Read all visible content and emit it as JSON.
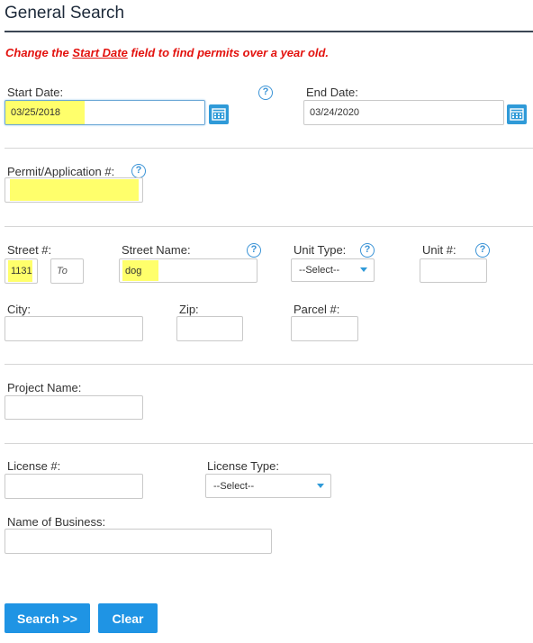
{
  "page": {
    "title": "General Search",
    "notice": {
      "prefix": "Change the ",
      "link": "Start Date",
      "suffix": " field to find permits over a year old."
    }
  },
  "form": {
    "start_date": {
      "label": "Start Date:",
      "value": "03/25/2018"
    },
    "end_date": {
      "label": "End Date:",
      "value": "03/24/2020"
    },
    "permit_number": {
      "label": "Permit/Application #:",
      "value": ""
    },
    "street_number": {
      "label": "Street #:",
      "from_value": "1131",
      "to_placeholder": "To"
    },
    "street_name": {
      "label": "Street Name:",
      "value": "dog"
    },
    "unit_type": {
      "label": "Unit Type:",
      "selected": "--Select--"
    },
    "unit_number": {
      "label": "Unit #:",
      "value": ""
    },
    "city": {
      "label": "City:",
      "value": ""
    },
    "zip": {
      "label": "Zip:",
      "value": ""
    },
    "parcel": {
      "label": "Parcel #:",
      "value": ""
    },
    "project_name": {
      "label": "Project Name:",
      "value": ""
    },
    "license_number": {
      "label": "License #:",
      "value": ""
    },
    "license_type": {
      "label": "License Type:",
      "selected": "--Select--"
    },
    "business_name": {
      "label": "Name of Business:",
      "value": ""
    }
  },
  "actions": {
    "search_label": "Search >>",
    "clear_label": "Clear"
  },
  "icons": {
    "help": "help-icon",
    "calendar": "calendar-icon",
    "help_glyph": "?"
  },
  "colors": {
    "accent": "#1f94e4",
    "notice": "#e3130f",
    "highlight": "#ffff6b"
  }
}
